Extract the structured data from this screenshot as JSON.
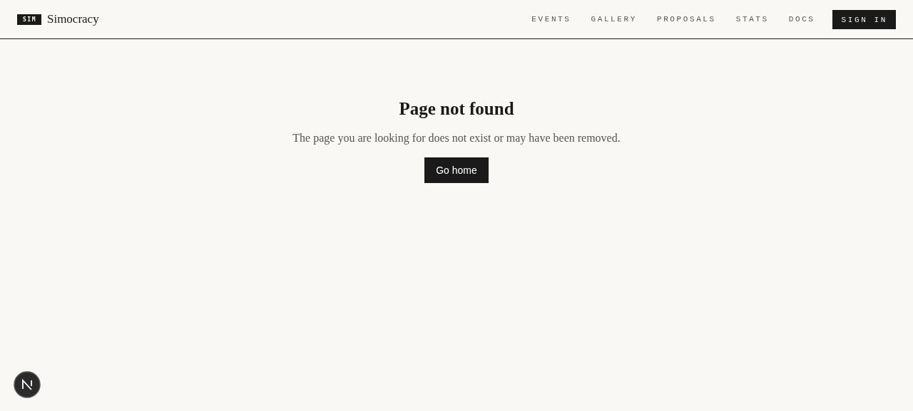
{
  "header": {
    "logo_badge": "SIM",
    "brand": "Simocracy",
    "nav": [
      {
        "label": "EVENTS"
      },
      {
        "label": "GALLERY"
      },
      {
        "label": "PROPOSALS"
      },
      {
        "label": "STATS"
      },
      {
        "label": "DOCS"
      }
    ],
    "sign_in": "SIGN IN"
  },
  "main": {
    "title": "Page not found",
    "message": "The page you are looking for does not exist or may have been removed.",
    "button": "Go home"
  }
}
